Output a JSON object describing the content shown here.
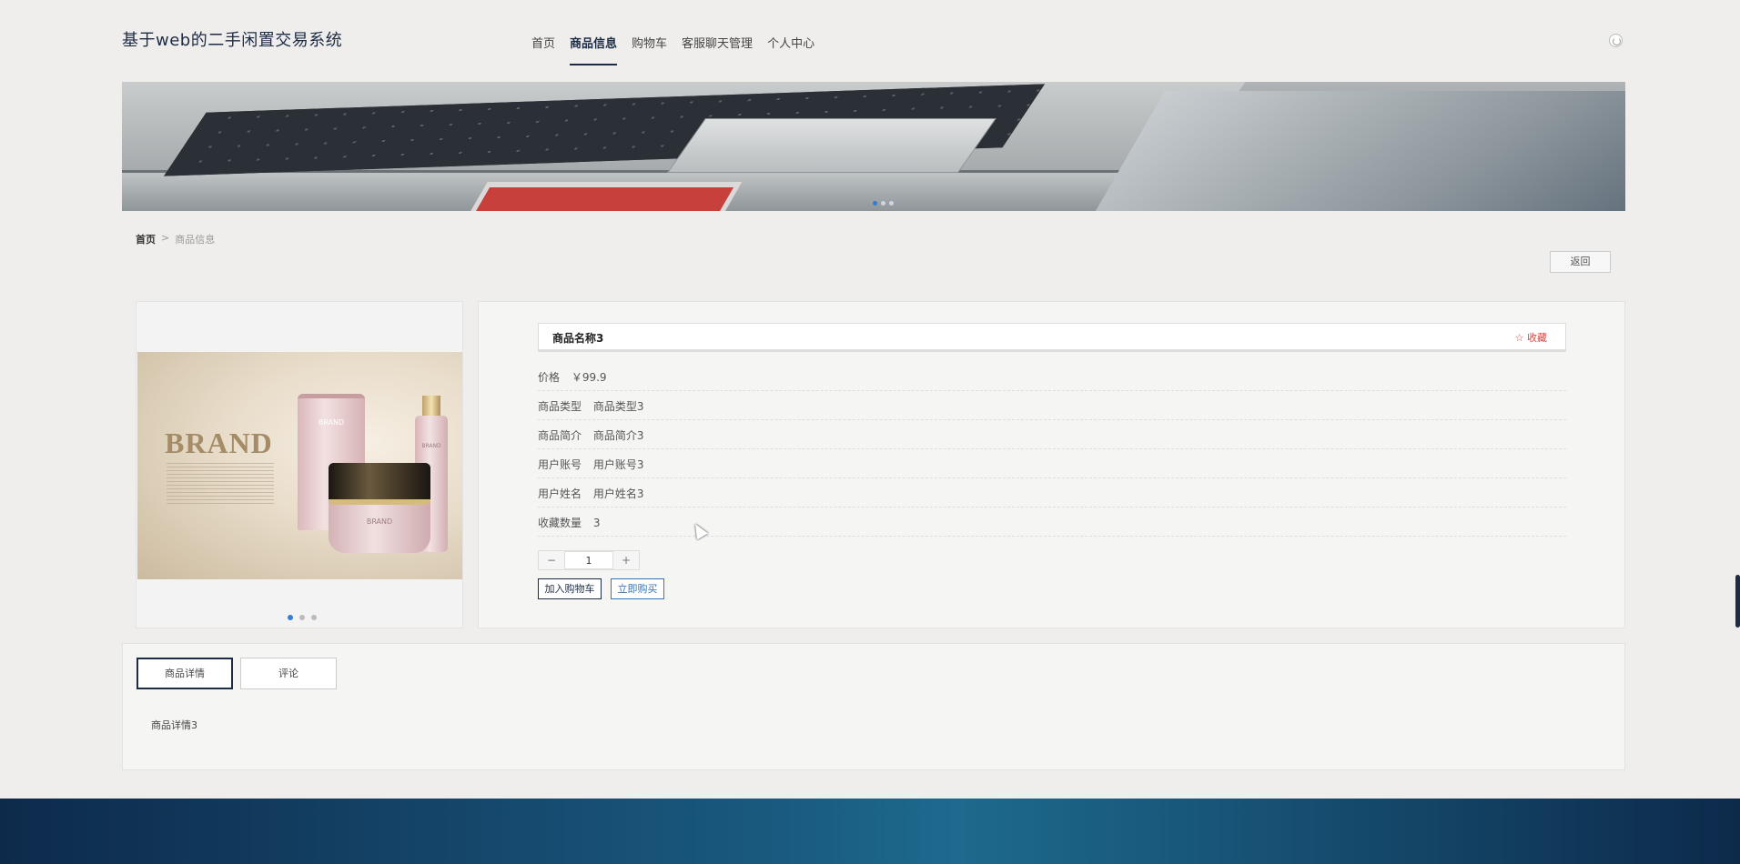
{
  "app": {
    "title": "基于web的二手闲置交易系统"
  },
  "nav": {
    "items": [
      {
        "label": "首页",
        "active": false
      },
      {
        "label": "商品信息",
        "active": true
      },
      {
        "label": "购物车",
        "active": false
      },
      {
        "label": "客服聊天管理",
        "active": false
      },
      {
        "label": "个人中心",
        "active": false
      }
    ]
  },
  "banner": {
    "slides": 3,
    "active_slide": 1
  },
  "breadcrumb": {
    "home": "首页",
    "separator": ">",
    "current": "商品信息"
  },
  "back_button": "返回",
  "product": {
    "name": "商品名称3",
    "favorite_label": "收藏",
    "image": {
      "brand_text": "BRAND",
      "tube_label": "BRAND",
      "bottle_label": "BRAND",
      "jar_label": "BRAND"
    },
    "gallery_dots": 3,
    "gallery_active": 1,
    "fields": [
      {
        "label": "价格",
        "value": "￥99.9"
      },
      {
        "label": "商品类型",
        "value": "商品类型3"
      },
      {
        "label": "商品简介",
        "value": "商品简介3"
      },
      {
        "label": "用户账号",
        "value": "用户账号3"
      },
      {
        "label": "用户姓名",
        "value": "用户姓名3"
      },
      {
        "label": "收藏数量",
        "value": "3"
      }
    ],
    "quantity": "1",
    "minus": "−",
    "plus": "+",
    "add_to_cart": "加入购物车",
    "buy_now": "立即购买"
  },
  "detail": {
    "tabs": [
      {
        "label": "商品详情",
        "active": true
      },
      {
        "label": "评论",
        "active": false
      }
    ],
    "content": "商品详情3"
  },
  "colors": {
    "accent": "#1d2c44",
    "favorite": "#d9443f",
    "buy": "#3a74b8",
    "dot_active": "#2e7fd6"
  }
}
